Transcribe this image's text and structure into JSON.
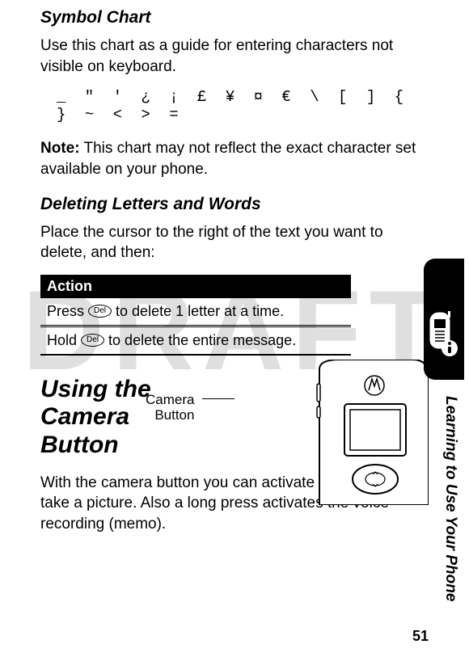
{
  "watermark": "DRAFT",
  "symbol_chart": {
    "heading": "Symbol Chart",
    "intro": "Use this chart as a guide for entering characters not visible on keyboard.",
    "symbols": "_ \" ' ¿ ¡ £ ¥ ¤ € \\ [ ] { } ~ < > =",
    "note_label": "Note:",
    "note_text": " This chart may not reflect the exact character set available on your phone."
  },
  "deleting": {
    "heading": "Deleting Letters and Words",
    "intro": "Place the cursor to the right of the text you want to delete, and then:",
    "action_header": "Action",
    "rows": {
      "r1_pre": "Press ",
      "r1_key": "Del",
      "r1_post": " to delete 1 letter at a time.",
      "r2_pre": "Hold ",
      "r2_key": "Del",
      "r2_post": " to delete the entire message."
    }
  },
  "camera": {
    "heading": "Using the Camera Button",
    "body": "With the camera button you can activate the camera and take a picture. Also a long press activates the voice recording (memo).",
    "label_line1": "Camera",
    "label_line2": "Button"
  },
  "side_label": "Learning to Use Your Phone",
  "page_number": "51"
}
